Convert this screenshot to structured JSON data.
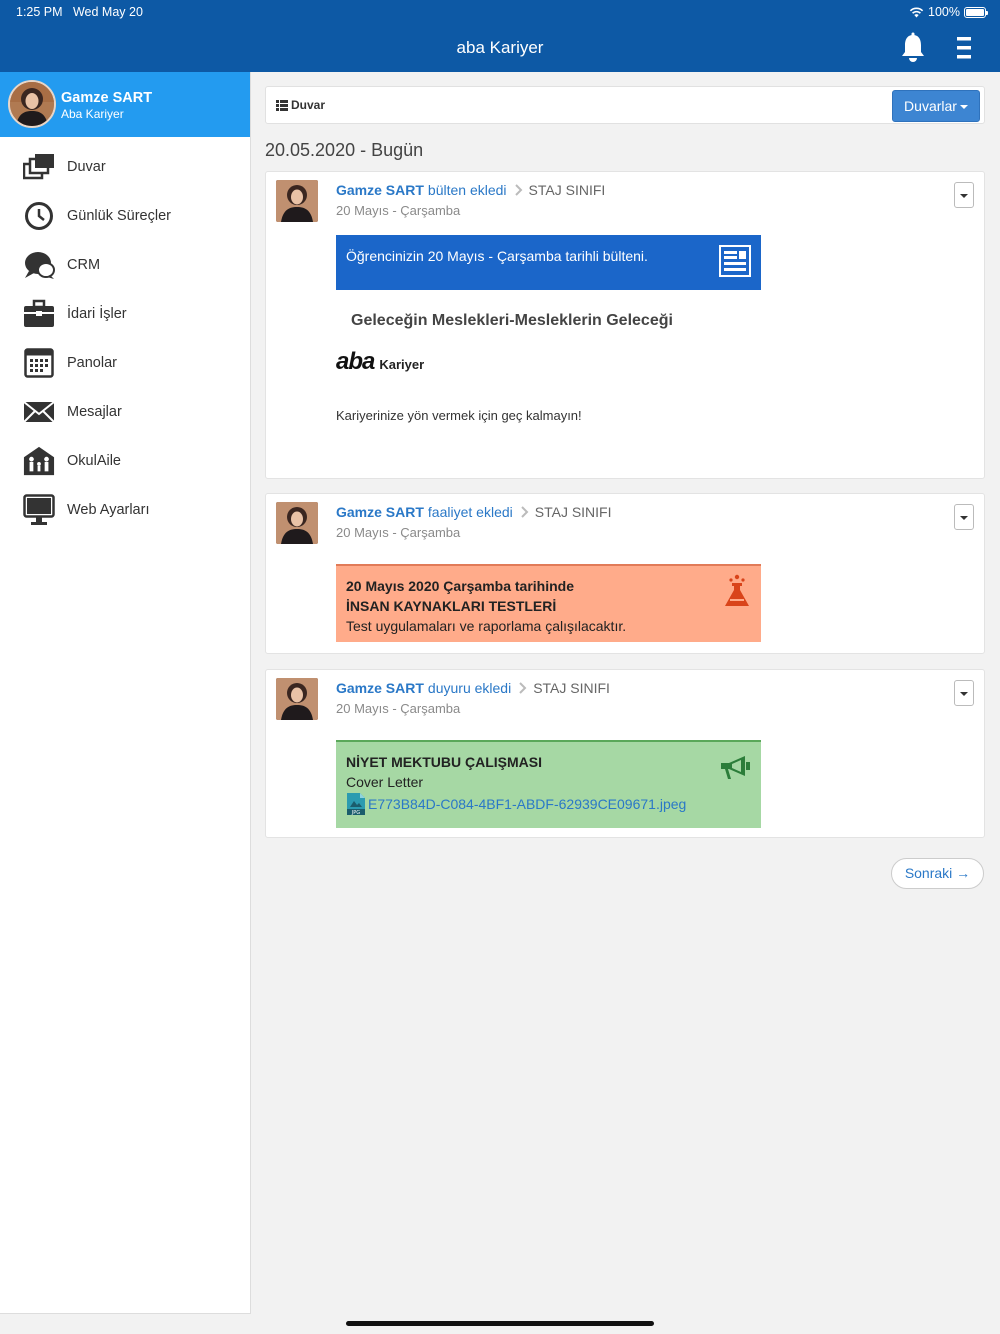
{
  "status_bar": {
    "time": "1:25 PM",
    "date": "Wed May 20",
    "battery": "100%"
  },
  "header": {
    "title": "aba Kariyer",
    "icons": [
      "bell-icon",
      "hamburger-menu-icon"
    ]
  },
  "sidebar": {
    "profile": {
      "name": "Gamze SART",
      "org": "Aba Kariyer"
    },
    "items": [
      {
        "label": "Duvar",
        "icon": "wall-stack-icon"
      },
      {
        "label": "Günlük Süreçler",
        "icon": "clock-icon"
      },
      {
        "label": "CRM",
        "icon": "chat-bubbles-icon"
      },
      {
        "label": "İdari İşler",
        "icon": "briefcase-icon"
      },
      {
        "label": "Panolar",
        "icon": "calendar-board-icon"
      },
      {
        "label": "Mesajlar",
        "icon": "envelope-icon"
      },
      {
        "label": "OkulAile",
        "icon": "family-icon"
      },
      {
        "label": "Web Ayarları",
        "icon": "monitor-icon"
      }
    ]
  },
  "toolbar": {
    "breadcrumb": "Duvar",
    "dropdown_label": "Duvarlar"
  },
  "feed": {
    "date_header": "20.05.2020 - Bugün",
    "posts": [
      {
        "author": "Gamze SART",
        "action": "bülten ekledi",
        "class": "STAJ SINIFI",
        "date": "20 Mayıs - Çarşamba",
        "banner_text": "Öğrencinizin 20 Mayıs - Çarşamba tarihli bülteni.",
        "news_title": "Geleceğin Meslekleri-Mesleklerin Geleceği",
        "logo_main": "aba",
        "logo_sub": "Kariyer",
        "body": "Kariyerinize yön vermek için geç kalmayın!"
      },
      {
        "author": "Gamze SART",
        "action": "faaliyet ekledi",
        "class": "STAJ SINIFI",
        "date": "20 Mayıs - Çarşamba",
        "line1": "20 Mayıs 2020 Çarşamba tarihinde",
        "line2": "İNSAN KAYNAKLARI TESTLERİ",
        "line3": "Test uygulamaları ve raporlama çalışılacaktır."
      },
      {
        "author": "Gamze SART",
        "action": "duyuru ekledi",
        "class": "STAJ SINIFI",
        "date": "20 Mayıs - Çarşamba",
        "title": "NİYET MEKTUBU ÇALIŞMASI",
        "subtitle": "Cover Letter",
        "file_name": "E773B84D-C084-4BF1-ABDF-62939CE09671.jpeg"
      }
    ],
    "next_label": "Sonraki →"
  },
  "colors": {
    "header_bg": "#0d59a5",
    "profile_bg": "#239bf0",
    "link": "#2a78c7",
    "bulletin_banner": "#1b66c9",
    "activity_banner": "#ffab8a",
    "announcement_banner": "#a6d8a4"
  }
}
